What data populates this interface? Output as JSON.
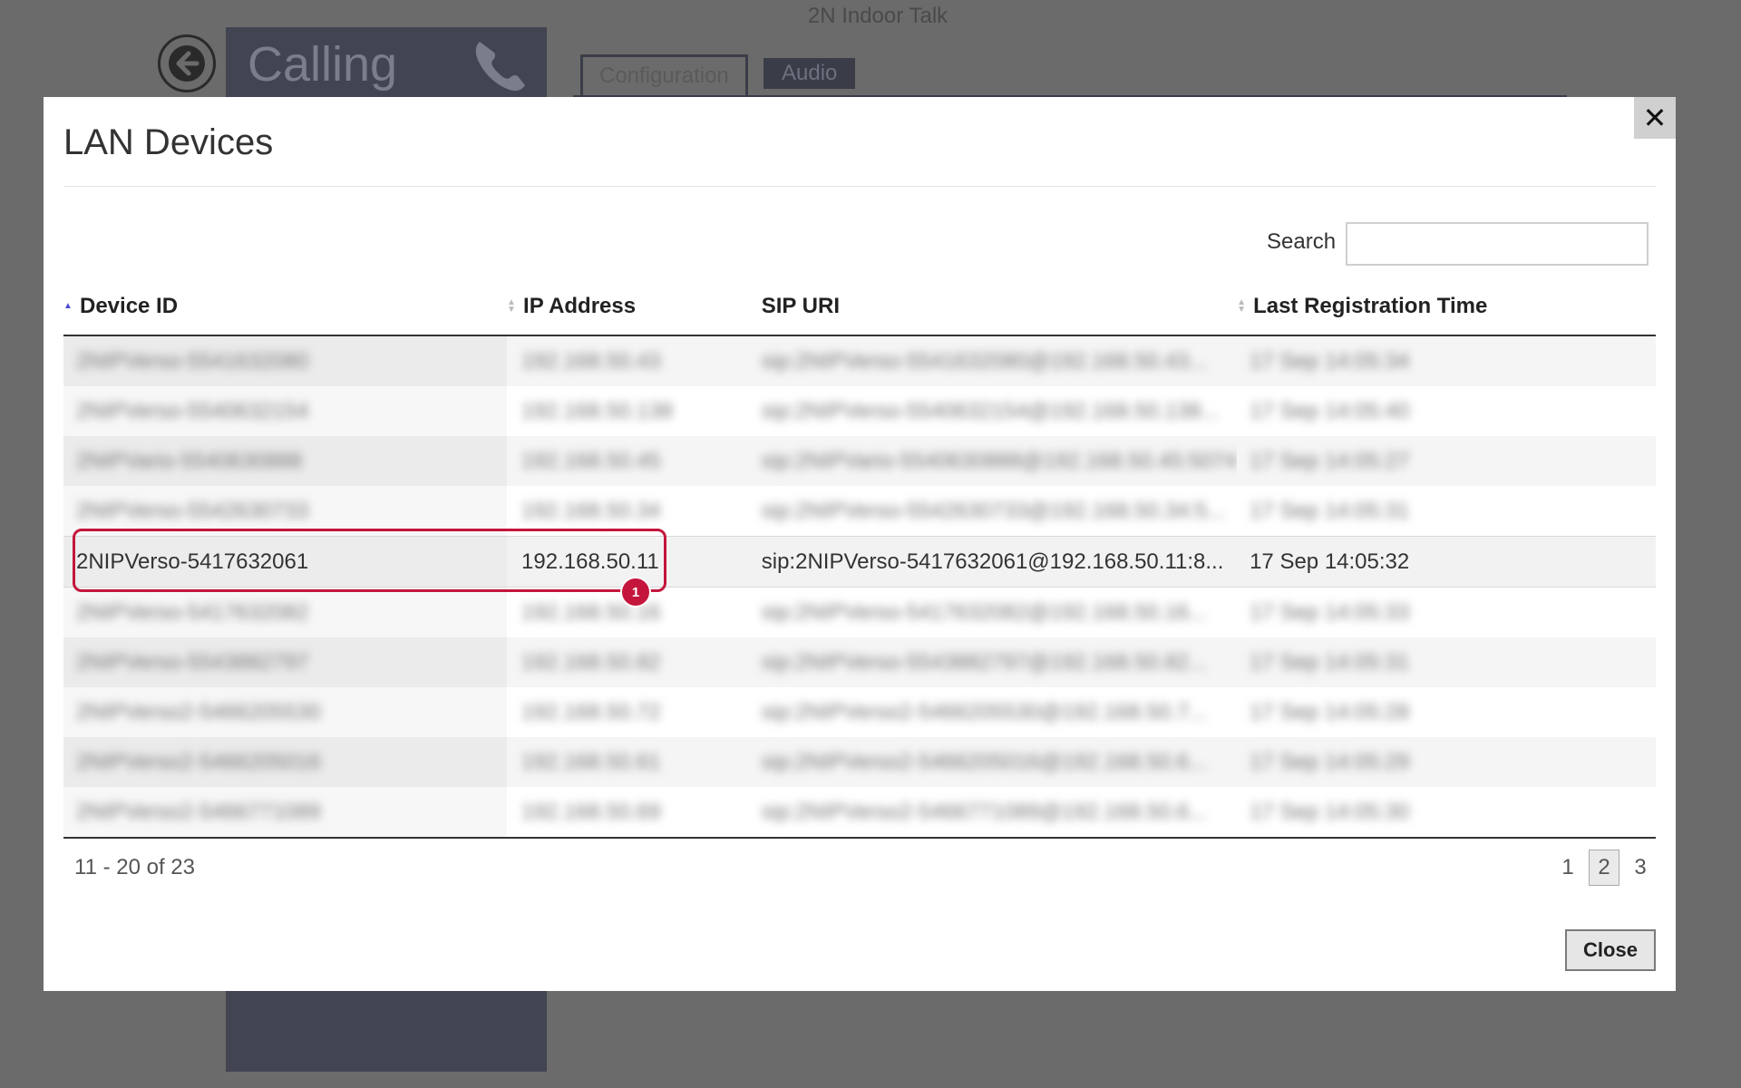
{
  "background": {
    "app_title": "2N Indoor Talk",
    "panel_title": "Calling",
    "tabs": [
      {
        "label": "Configuration"
      },
      {
        "label": "Audio"
      }
    ]
  },
  "modal": {
    "title": "LAN Devices",
    "close_x": "✕",
    "search_label": "Search",
    "search_value": "",
    "columns": [
      {
        "label": "Device ID"
      },
      {
        "label": "IP Address"
      },
      {
        "label": "SIP URI"
      },
      {
        "label": "Last Registration Time"
      }
    ],
    "rows": [
      {
        "device_id": "2NIPVerso-5541632080",
        "ip": "192.168.50.43",
        "sip": "sip:2NIPVerso-5541632080@192.168.50.43...",
        "time": "17 Sep 14:05:34",
        "blurred": true
      },
      {
        "device_id": "2NIPVerso-5540632154",
        "ip": "192.168.50.138",
        "sip": "sip:2NIPVerso-5540632154@192.168.50.138...",
        "time": "17 Sep 14:05:40",
        "blurred": true
      },
      {
        "device_id": "2NIPVario-5540630888",
        "ip": "192.168.50.45",
        "sip": "sip:2NIPVario-5540630888@192.168.50.45:5074",
        "time": "17 Sep 14:05:27",
        "blurred": true
      },
      {
        "device_id": "2NIPVerso-5542630733",
        "ip": "192.168.50.34",
        "sip": "sip:2NIPVerso-5542630733@192.168.50.34:5...",
        "time": "17 Sep 14:05:31",
        "blurred": true
      },
      {
        "device_id": "2NIPVerso-5417632061",
        "ip": "192.168.50.11",
        "sip": "sip:2NIPVerso-5417632061@192.168.50.11:8...",
        "time": "17 Sep 14:05:32",
        "blurred": false
      },
      {
        "device_id": "2NIPVerso-5417632082",
        "ip": "192.168.50.16",
        "sip": "sip:2NIPVerso-5417632082@192.168.50.16...",
        "time": "17 Sep 14:05:33",
        "blurred": true
      },
      {
        "device_id": "2NIPVerso-5543882797",
        "ip": "192.168.50.82",
        "sip": "sip:2NIPVerso-5543882797@192.168.50.82...",
        "time": "17 Sep 14:05:31",
        "blurred": true
      },
      {
        "device_id": "2NIPVerso2-5466205530",
        "ip": "192.168.50.72",
        "sip": "sip:2NIPVerso2-5466205530@192.168.50.7...",
        "time": "17 Sep 14:05:28",
        "blurred": true
      },
      {
        "device_id": "2NIPVerso2-5466205016",
        "ip": "192.168.50.61",
        "sip": "sip:2NIPVerso2-5466205016@192.168.50.6...",
        "time": "17 Sep 14:05:29",
        "blurred": true
      },
      {
        "device_id": "2NIPVerso2-5466771089",
        "ip": "192.168.50.69",
        "sip": "sip:2NIPVerso2-5466771089@192.168.50.6...",
        "time": "17 Sep 14:05:30",
        "blurred": true
      }
    ],
    "selected_row_index": 4,
    "marker_label": "1",
    "info": "11 - 20 of 23",
    "pages": [
      "1",
      "2",
      "3"
    ],
    "current_page": "2",
    "close_button": "Close"
  },
  "colors": {
    "backdrop": "#6b6b6b",
    "panel": "#424452",
    "highlight": "#c4163c"
  }
}
